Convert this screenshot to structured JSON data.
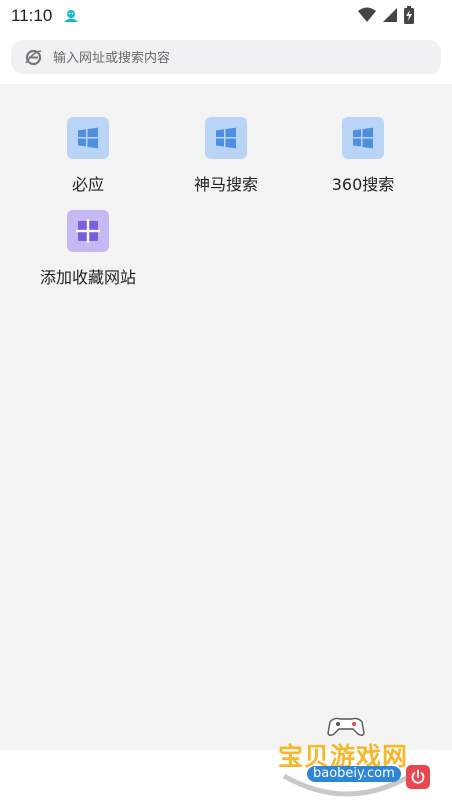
{
  "status_bar": {
    "time": "11:10",
    "icons": [
      "person-notification-icon",
      "wifi-icon",
      "cellular-signal-icon",
      "battery-charging-icon"
    ]
  },
  "search": {
    "placeholder": "输入网址或搜索内容",
    "icon": "browser-e-icon"
  },
  "shortcuts": [
    {
      "label": "必应",
      "icon": "windows-icon",
      "color": "#b9d4f4"
    },
    {
      "label": "神马搜索",
      "icon": "windows-icon",
      "color": "#b9d4f4"
    },
    {
      "label": "360搜索",
      "icon": "windows-icon",
      "color": "#b9d4f4"
    },
    {
      "label": "添加收藏网站",
      "icon": "add-icon",
      "color": "#c6b8f1"
    }
  ],
  "watermark": {
    "title": "宝贝游戏网",
    "domain": "baobeiy.com"
  },
  "colors": {
    "content_bg": "#f3f3f4",
    "search_bg": "#f1f1f3",
    "accent_blue": "#4f8fe0",
    "accent_purple": "#7c5ce0"
  }
}
